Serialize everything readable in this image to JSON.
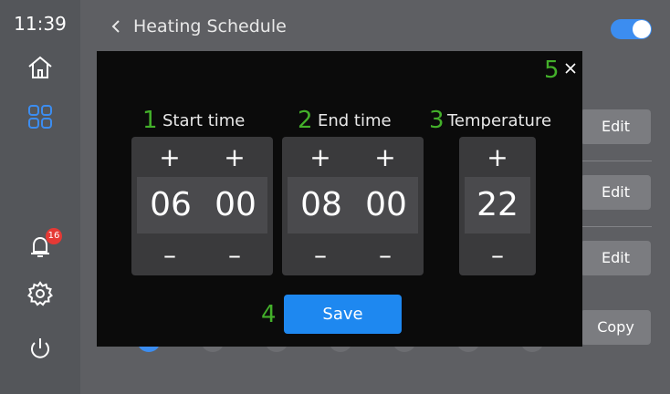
{
  "status": {
    "time": "11:39",
    "notification_count": "16"
  },
  "sidebar": {
    "icons": [
      "home-icon",
      "grid-icon",
      "bell-icon",
      "gear-icon",
      "power-icon"
    ],
    "active_color": "#3c8df0"
  },
  "header": {
    "title": "Heating Schedule",
    "toggle_on": true
  },
  "background_buttons": {
    "edit_1": "Edit",
    "edit_2": "Edit",
    "edit_3": "Edit",
    "copy": "Copy"
  },
  "modal": {
    "step_1": "1",
    "step_2": "2",
    "step_3": "3",
    "step_4": "4",
    "step_5": "5",
    "close_glyph": "×",
    "start_label": "Start time",
    "end_label": "End time",
    "temp_label": "Temperature",
    "plus": "+",
    "minus": "–",
    "start_hour": "06",
    "start_minute": "00",
    "end_hour": "08",
    "end_minute": "00",
    "temperature": "22",
    "save_label": "Save"
  },
  "colors": {
    "accent": "#1e88f0",
    "step_marker": "#43b02a",
    "badge": "#e53935"
  }
}
